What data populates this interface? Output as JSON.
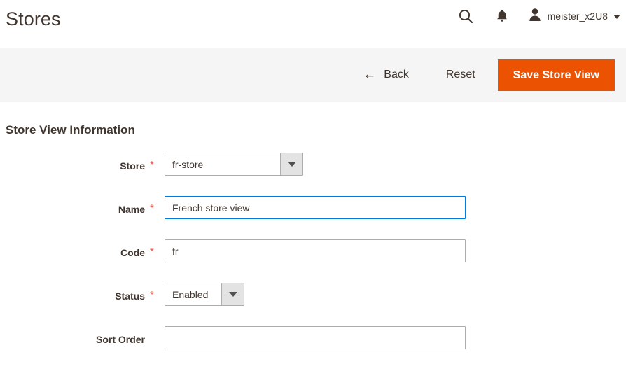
{
  "header": {
    "page_title": "Stores",
    "search_icon": "search-icon",
    "notifications_icon": "bell-icon",
    "avatar_icon": "user-avatar-icon",
    "user_name": "meister_x2U8",
    "caret_icon": "chevron-down-icon"
  },
  "toolbar": {
    "back_label": "Back",
    "back_icon": "arrow-left-icon",
    "reset_label": "Reset",
    "save_label": "Save Store View",
    "save_color": "#eb5202"
  },
  "main": {
    "section_title": "Store View Information",
    "required_marker": "*",
    "fields": [
      {
        "label": "Store",
        "required": true,
        "type": "select",
        "value": "fr-store"
      },
      {
        "label": "Name",
        "required": true,
        "type": "text",
        "value": "French store view",
        "focused": true
      },
      {
        "label": "Code",
        "required": true,
        "type": "text",
        "value": "fr",
        "focused": false
      },
      {
        "label": "Status",
        "required": true,
        "type": "select",
        "value": "Enabled"
      },
      {
        "label": "Sort Order",
        "required": false,
        "type": "text",
        "value": "",
        "focused": false
      }
    ]
  }
}
